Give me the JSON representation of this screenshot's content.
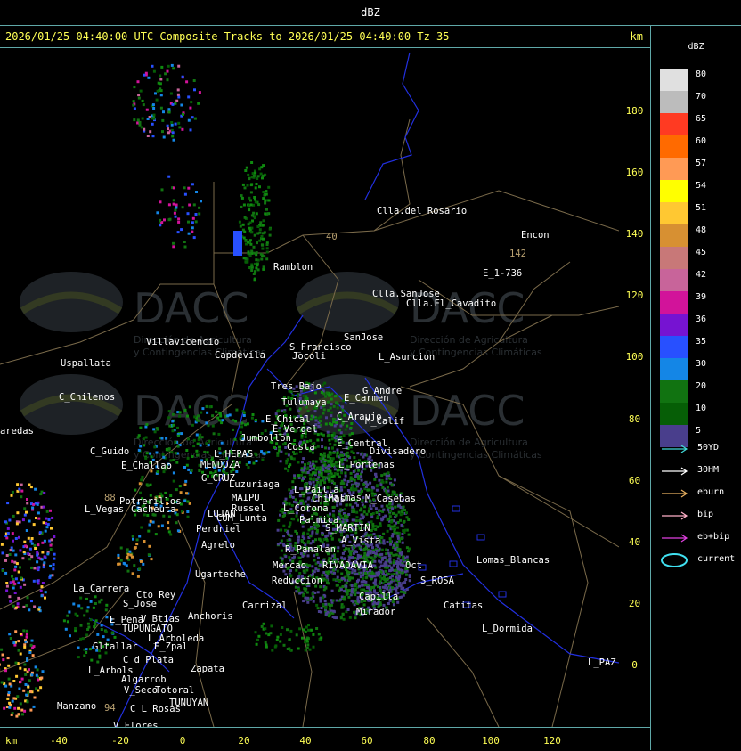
{
  "header": {
    "unit": "dBZ"
  },
  "title": {
    "text": "2026/01/25 04:40:00 UTC Composite Tracks to 2026/01/25 04:40:00 Tz 35",
    "unit": "km"
  },
  "axes": {
    "x_unit": "km",
    "x_ticks": [
      "-40",
      "-20",
      "0",
      "20",
      "40",
      "60",
      "80",
      "100",
      "120"
    ],
    "y_ticks": [
      "180",
      "160",
      "140",
      "120",
      "100",
      "80",
      "60",
      "40",
      "20",
      "0"
    ]
  },
  "legend": {
    "title": "dBZ",
    "levels": [
      {
        "label": "80",
        "color": "#e0e0e0"
      },
      {
        "label": "70",
        "color": "#bcbcbc"
      },
      {
        "label": "65",
        "color": "#ff3a22"
      },
      {
        "label": "60",
        "color": "#ff6a00"
      },
      {
        "label": "57",
        "color": "#ff9a55"
      },
      {
        "label": "54",
        "color": "#ffff00"
      },
      {
        "label": "51",
        "color": "#ffc832"
      },
      {
        "label": "48",
        "color": "#d79032"
      },
      {
        "label": "45",
        "color": "#c87878"
      },
      {
        "label": "42",
        "color": "#c8649a"
      },
      {
        "label": "39",
        "color": "#d2139a"
      },
      {
        "label": "36",
        "color": "#7613d2"
      },
      {
        "label": "35",
        "color": "#2850ff"
      },
      {
        "label": "30",
        "color": "#1486e6"
      },
      {
        "label": "20",
        "color": "#117311"
      },
      {
        "label": "10",
        "color": "#065e06"
      },
      {
        "label": "5",
        "color": "#493e8c"
      }
    ],
    "tracks": [
      {
        "label": "50YD",
        "color": "#40d8d8"
      },
      {
        "label": "30HM",
        "color": "#ffffff"
      },
      {
        "label": "eburn",
        "color": "#e8b060"
      },
      {
        "label": "bip",
        "color": "#ffb0c8"
      },
      {
        "label": "eb+bip",
        "color": "#e040e0"
      }
    ],
    "current_label": "current"
  },
  "watermark": {
    "brand": "DACC",
    "line1": "Dirección de Agricultura",
    "line2": "y Contingencias Climáticas"
  },
  "places": [
    {
      "name": "Clla.del_Rosario"
    },
    {
      "name": "Encon"
    },
    {
      "name": "142"
    },
    {
      "name": "E_1-736"
    },
    {
      "name": "Ramblon"
    },
    {
      "name": "40"
    },
    {
      "name": "Clla.SanJose"
    },
    {
      "name": "Clla.El_Cavadito"
    },
    {
      "name": "Uspallata"
    },
    {
      "name": "Villavicencio"
    },
    {
      "name": "Capdevila"
    },
    {
      "name": "S_Francisco"
    },
    {
      "name": "Jocoli"
    },
    {
      "name": "SanJose"
    },
    {
      "name": "L_Asuncion"
    },
    {
      "name": "C_Chilenos"
    },
    {
      "name": "Tres_Bajo"
    },
    {
      "name": "Tulumaya"
    },
    {
      "name": "E_Carmen"
    },
    {
      "name": "G_Andre"
    },
    {
      "name": "aredas"
    },
    {
      "name": "E_Chical"
    },
    {
      "name": "E_Vergel"
    },
    {
      "name": "C_Araujo"
    },
    {
      "name": "M_Calif"
    },
    {
      "name": "Jumbollon"
    },
    {
      "name": "Costa"
    },
    {
      "name": "E_Central"
    },
    {
      "name": "Divisadero"
    },
    {
      "name": "C_Guido"
    },
    {
      "name": "L_HEPAS"
    },
    {
      "name": "L_Portenas"
    },
    {
      "name": "E_Challao"
    },
    {
      "name": "MENDOZA"
    },
    {
      "name": "G_CRUZ"
    },
    {
      "name": "Luzuriaga"
    },
    {
      "name": "L_Pailla"
    },
    {
      "name": "Palmas"
    },
    {
      "name": "Potrerillos"
    },
    {
      "name": "88"
    },
    {
      "name": "MAIPU"
    },
    {
      "name": "Chinas"
    },
    {
      "name": "M_Casebas"
    },
    {
      "name": "L_Vegas"
    },
    {
      "name": "Cacheuta"
    },
    {
      "name": "Russel"
    },
    {
      "name": "L_Corona"
    },
    {
      "name": "LUJAN"
    },
    {
      "name": "CUM_Lunta"
    },
    {
      "name": "Palmica"
    },
    {
      "name": "Perdriel"
    },
    {
      "name": "S_MARTIN"
    },
    {
      "name": "A_Vista"
    },
    {
      "name": "Agrelo"
    },
    {
      "name": "R_Panalan"
    },
    {
      "name": "Lomas_Blancas"
    },
    {
      "name": "Ugarteche"
    },
    {
      "name": "Mercao"
    },
    {
      "name": "RIVADAVIA"
    },
    {
      "name": "Oct"
    },
    {
      "name": "La_Carrera"
    },
    {
      "name": "Cto_Rey"
    },
    {
      "name": "Reduccion"
    },
    {
      "name": "S_ROSA"
    },
    {
      "name": "S_Jose"
    },
    {
      "name": "Carrizal"
    },
    {
      "name": "Catitas"
    },
    {
      "name": "E_Pena"
    },
    {
      "name": "V_Btias"
    },
    {
      "name": "Anchoris"
    },
    {
      "name": "Capilla"
    },
    {
      "name": "TUPUNGATO"
    },
    {
      "name": "L_Arboleda"
    },
    {
      "name": "L_Dormida"
    },
    {
      "name": "Mirador"
    },
    {
      "name": "Gltallar"
    },
    {
      "name": "E_Zpal"
    },
    {
      "name": "C_d_Plata"
    },
    {
      "name": "L_Arbols"
    },
    {
      "name": "Zapata"
    },
    {
      "name": "L_PAZ"
    },
    {
      "name": "Algarrob"
    },
    {
      "name": "V_Seco"
    },
    {
      "name": "Totoral"
    },
    {
      "name": "TUNUYAN"
    },
    {
      "name": "Manzano"
    },
    {
      "name": "94"
    },
    {
      "name": "C_L_Rosas"
    },
    {
      "name": "V_Flores"
    }
  ]
}
